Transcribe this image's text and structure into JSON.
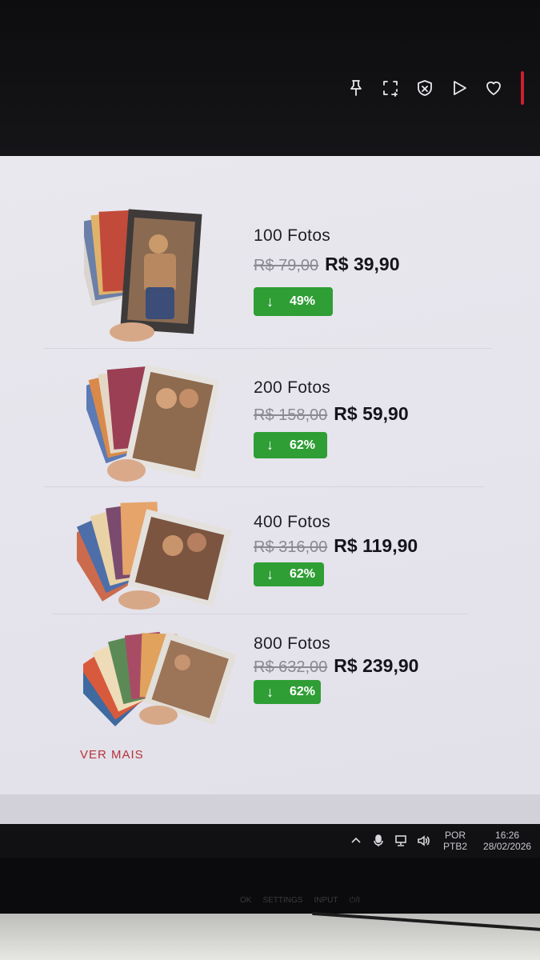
{
  "toolbar": {
    "icons": [
      "pin-icon",
      "screen-capture-icon",
      "shield-icon",
      "play-icon",
      "heart-icon"
    ]
  },
  "products": [
    {
      "name": "100 Fotos",
      "old_price": "R$ 79,00",
      "new_price": "R$ 39,90",
      "discount": "49%"
    },
    {
      "name": "200 Fotos",
      "old_price": "R$ 158,00",
      "new_price": "R$ 59,90",
      "discount": "62%"
    },
    {
      "name": "400 Fotos",
      "old_price": "R$ 316,00",
      "new_price": "R$ 119,90",
      "discount": "62%"
    },
    {
      "name": "800 Fotos",
      "old_price": "R$ 632,00",
      "new_price": "R$ 239,90",
      "discount": "62%"
    }
  ],
  "discount_arrow": "↓",
  "ver_mais": "VER MAIS",
  "colors": {
    "badge": "#2f9e35",
    "link": "#b5343a",
    "accent_bar": "#c8222a"
  },
  "taskbar": {
    "lang_top": "POR",
    "lang_bottom": "PTB2",
    "time": "16:26",
    "date": "28/02/2026"
  },
  "bezel": {
    "labels": [
      "OK",
      "SETTINGS",
      "INPUT",
      "⏻/I"
    ]
  }
}
